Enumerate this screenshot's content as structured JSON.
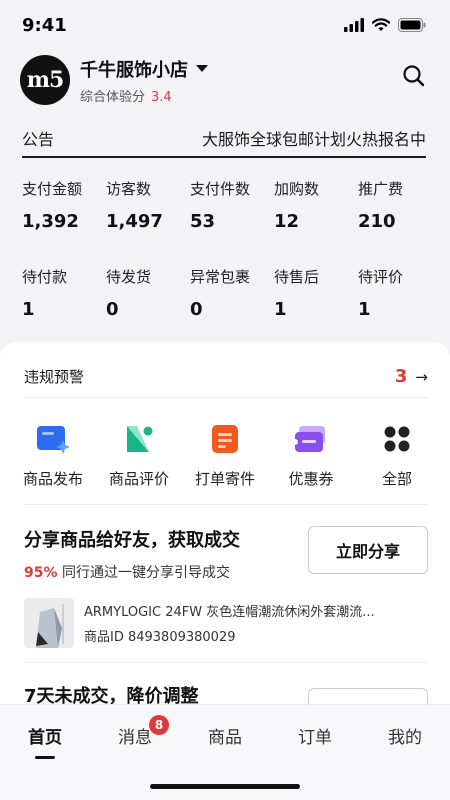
{
  "status": {
    "time": "9:41"
  },
  "header": {
    "avatar_text": "m5",
    "shop_name": "千牛服饰小店",
    "score_label": "综合体验分",
    "score_value": "3.4"
  },
  "notice": {
    "label": "公告",
    "text": "大服饰全球包邮计划火热报名中"
  },
  "stats": {
    "row1": [
      {
        "label": "支付金额",
        "value": "1,392"
      },
      {
        "label": "访客数",
        "value": "1,497"
      },
      {
        "label": "支付件数",
        "value": "53"
      },
      {
        "label": "加购数",
        "value": "12"
      },
      {
        "label": "推广费",
        "value": "210"
      }
    ],
    "row2": [
      {
        "label": "待付款",
        "value": "1"
      },
      {
        "label": "待发货",
        "value": "0"
      },
      {
        "label": "异常包裹",
        "value": "0"
      },
      {
        "label": "待售后",
        "value": "1"
      },
      {
        "label": "待评价",
        "value": "1"
      }
    ]
  },
  "violation": {
    "label": "违规预警",
    "count": "3",
    "arrow": "→"
  },
  "actions": [
    {
      "label": "商品发布",
      "icon": "publish-icon",
      "color": "#2f6bf0"
    },
    {
      "label": "商品评价",
      "icon": "review-icon",
      "color": "#19b58a"
    },
    {
      "label": "打单寄件",
      "icon": "print-icon",
      "color": "#f05a1e"
    },
    {
      "label": "优惠券",
      "icon": "coupon-icon",
      "color": "#8a4ef0"
    },
    {
      "label": "全部",
      "icon": "grid-icon",
      "color": "#222222"
    }
  ],
  "share": {
    "title": "分享商品给好友，获取成交",
    "rate": "95%",
    "subtitle": "同行通过一键分享引导成交",
    "button": "立即分享",
    "product_title": "ARMYLOGIC 24FW 灰色连帽潮流休闲外套潮流...",
    "product_id": "商品ID 8493809380029"
  },
  "price": {
    "title": "7天未成交，降价调整"
  },
  "tabs": [
    {
      "label": "首页",
      "active": true
    },
    {
      "label": "消息",
      "badge": "8"
    },
    {
      "label": "商品"
    },
    {
      "label": "订单"
    },
    {
      "label": "我的"
    }
  ],
  "colors": {
    "accent_red": "#e0393b",
    "background": "#f3f3f5"
  }
}
